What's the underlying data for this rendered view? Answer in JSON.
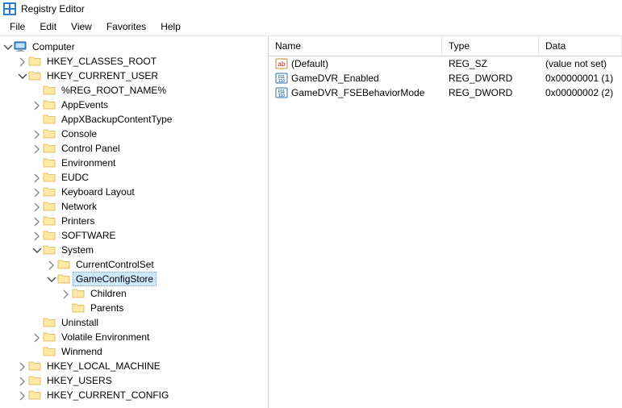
{
  "window": {
    "title": "Registry Editor"
  },
  "menu": {
    "file": "File",
    "edit": "Edit",
    "view": "View",
    "favorites": "Favorites",
    "help": "Help"
  },
  "columns": {
    "name": "Name",
    "type": "Type",
    "data": "Data"
  },
  "tree": {
    "computer": "Computer",
    "hkcr": "HKEY_CLASSES_ROOT",
    "hkcu": "HKEY_CURRENT_USER",
    "reg_root": "%REG_ROOT_NAME%",
    "appevents": "AppEvents",
    "appxbackup": "AppXBackupContentType",
    "console": "Console",
    "controlpanel": "Control Panel",
    "environment": "Environment",
    "eudc": "EUDC",
    "keyboard": "Keyboard Layout",
    "network": "Network",
    "printers": "Printers",
    "software": "SOFTWARE",
    "system": "System",
    "currentcontrolset": "CurrentControlSet",
    "gameconfigstore": "GameConfigStore",
    "children": "Children",
    "parents": "Parents",
    "uninstall": "Uninstall",
    "volatileenv": "Volatile Environment",
    "winmend": "Winmend",
    "hklm": "HKEY_LOCAL_MACHINE",
    "hku": "HKEY_USERS",
    "hkcc": "HKEY_CURRENT_CONFIG"
  },
  "values": [
    {
      "name": "(Default)",
      "type": "REG_SZ",
      "data": "(value not set)",
      "kind": "string"
    },
    {
      "name": "GameDVR_Enabled",
      "type": "REG_DWORD",
      "data": "0x00000001 (1)",
      "kind": "binary"
    },
    {
      "name": "GameDVR_FSEBehaviorMode",
      "type": "REG_DWORD",
      "data": "0x00000002 (2)",
      "kind": "binary"
    }
  ]
}
